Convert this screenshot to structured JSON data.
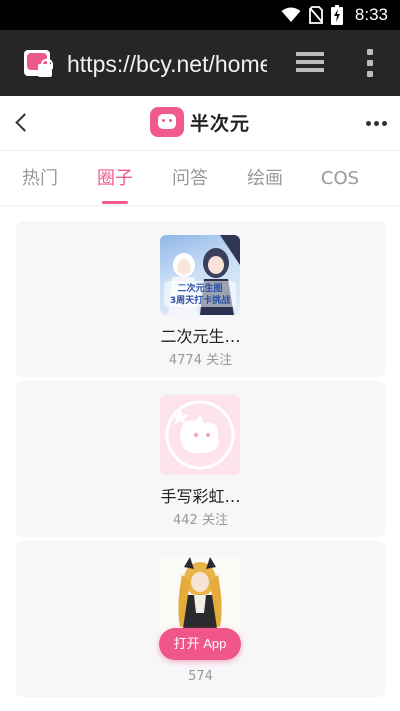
{
  "status_bar": {
    "time": "8:33",
    "icons": [
      "wifi-icon",
      "no-sim-icon",
      "battery-charging-icon"
    ]
  },
  "browser": {
    "url": "https://bcy.net/home"
  },
  "site": {
    "name": "半次元",
    "brand_color": "#f15a8f"
  },
  "tabs": [
    {
      "label": "热门",
      "active": false
    },
    {
      "label": "圈子",
      "active": true
    },
    {
      "label": "问答",
      "active": false
    },
    {
      "label": "绘画",
      "active": false
    },
    {
      "label": "COS",
      "active": false
    }
  ],
  "circles": [
    {
      "title": "二次元生…",
      "followers": "4774 关注",
      "image_text": "二次元生图 3周天打卡挑战"
    },
    {
      "title": "手写彩虹…",
      "followers": "442 关注"
    },
    {
      "title": "",
      "followers": "574"
    }
  ],
  "open_app": {
    "label": "打开 App"
  }
}
